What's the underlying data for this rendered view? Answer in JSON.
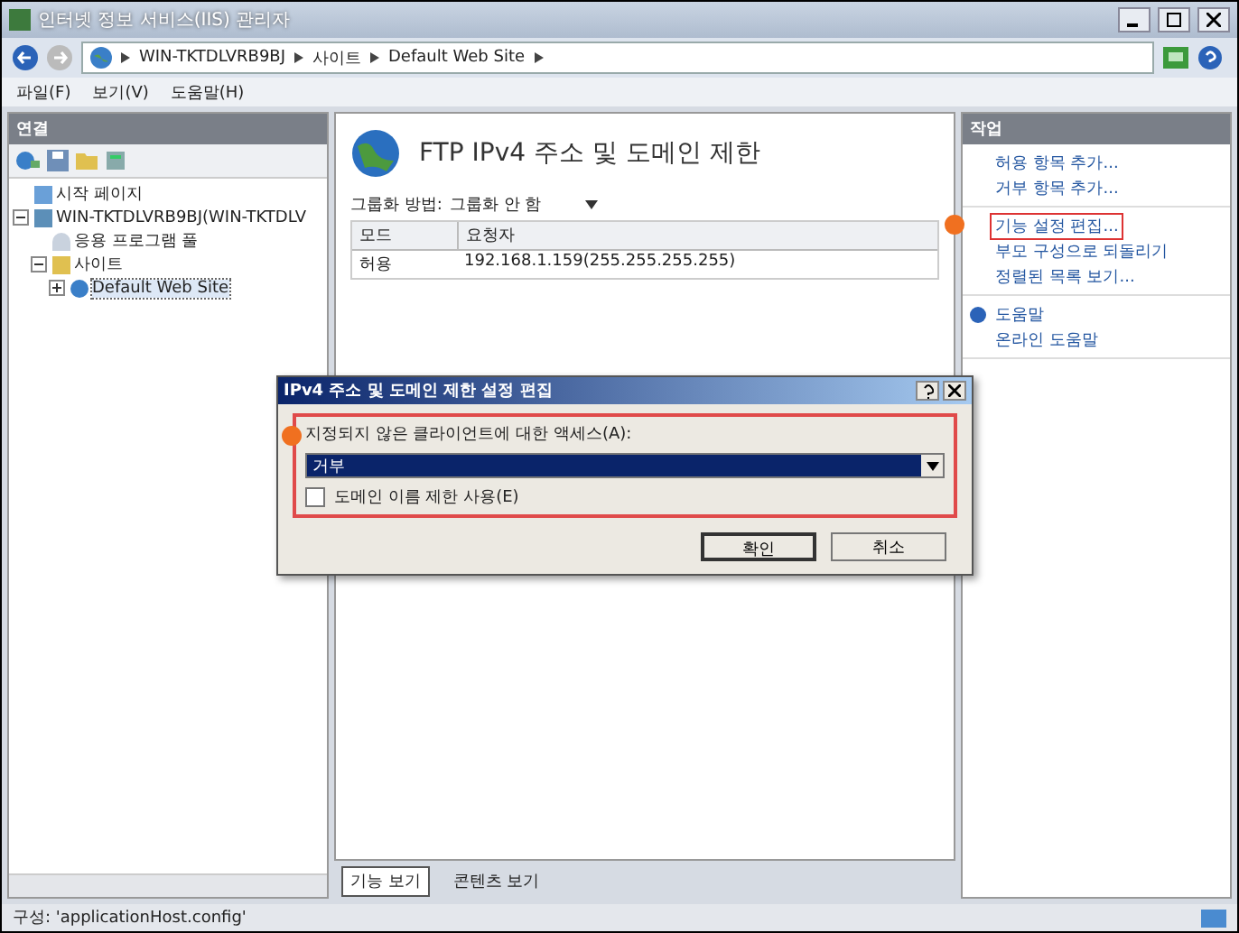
{
  "window": {
    "title": "인터넷 정보 서비스(IIS) 관리자"
  },
  "address": {
    "crumbs": [
      "WIN-TKTDLVRB9BJ",
      "사이트",
      "Default Web Site"
    ]
  },
  "menu": [
    "파일(F)",
    "보기(V)",
    "도움말(H)"
  ],
  "connections": {
    "title": "연결",
    "tree": [
      {
        "label": "시작 페이지",
        "kind": "page",
        "selected": false
      },
      {
        "label": "WIN-TKTDLVRB9BJ(WIN-TKTDLV",
        "kind": "server",
        "selected": false,
        "expanded": true,
        "children": [
          {
            "label": "응용 프로그램 풀",
            "kind": "pool",
            "selected": false
          },
          {
            "label": "사이트",
            "kind": "folder",
            "selected": false,
            "expanded": true,
            "children": [
              {
                "label": "Default Web Site",
                "kind": "site",
                "selected": true,
                "expanded": false
              }
            ]
          }
        ]
      }
    ]
  },
  "feature": {
    "title": "FTP IPv4 주소 및 도메인 제한",
    "group_label": "그룹화 방법:",
    "group_value": "그룹화 안 함",
    "columns": [
      "모드",
      "요청자"
    ],
    "rows": [
      [
        "허용",
        "192.168.1.159(255.255.255.255)"
      ]
    ],
    "view_tabs": [
      {
        "label": "기능 보기",
        "selected": true
      },
      {
        "label": "콘텐츠 보기",
        "selected": false
      }
    ]
  },
  "actions": {
    "title": "작업",
    "groups": [
      {
        "items": [
          {
            "label": "허용 항목 추가...",
            "highlighted": false
          },
          {
            "label": "거부 항목 추가...",
            "highlighted": false
          }
        ]
      },
      {
        "items": [
          {
            "label": "기능 설정 편집...",
            "highlighted": true
          },
          {
            "label": "부모 구성으로 되돌리기",
            "highlighted": false
          },
          {
            "label": "정렬된 목록 보기...",
            "highlighted": false
          }
        ]
      },
      {
        "items": [
          {
            "label": "도움말",
            "kind": "help",
            "highlighted": false
          },
          {
            "label": "온라인 도움말",
            "highlighted": false
          }
        ]
      }
    ]
  },
  "dialog": {
    "title": "IPv4 주소 및 도메인 제한 설정 편집",
    "access_label": "지정되지 않은 클라이언트에 대한 액세스(A):",
    "access_value": "거부",
    "domain_checkbox": {
      "label": "도메인 이름 제한 사용(E)",
      "checked": false
    },
    "buttons": [
      "확인",
      "취소"
    ]
  },
  "status_bar": "구성: 'applicationHost.config'"
}
